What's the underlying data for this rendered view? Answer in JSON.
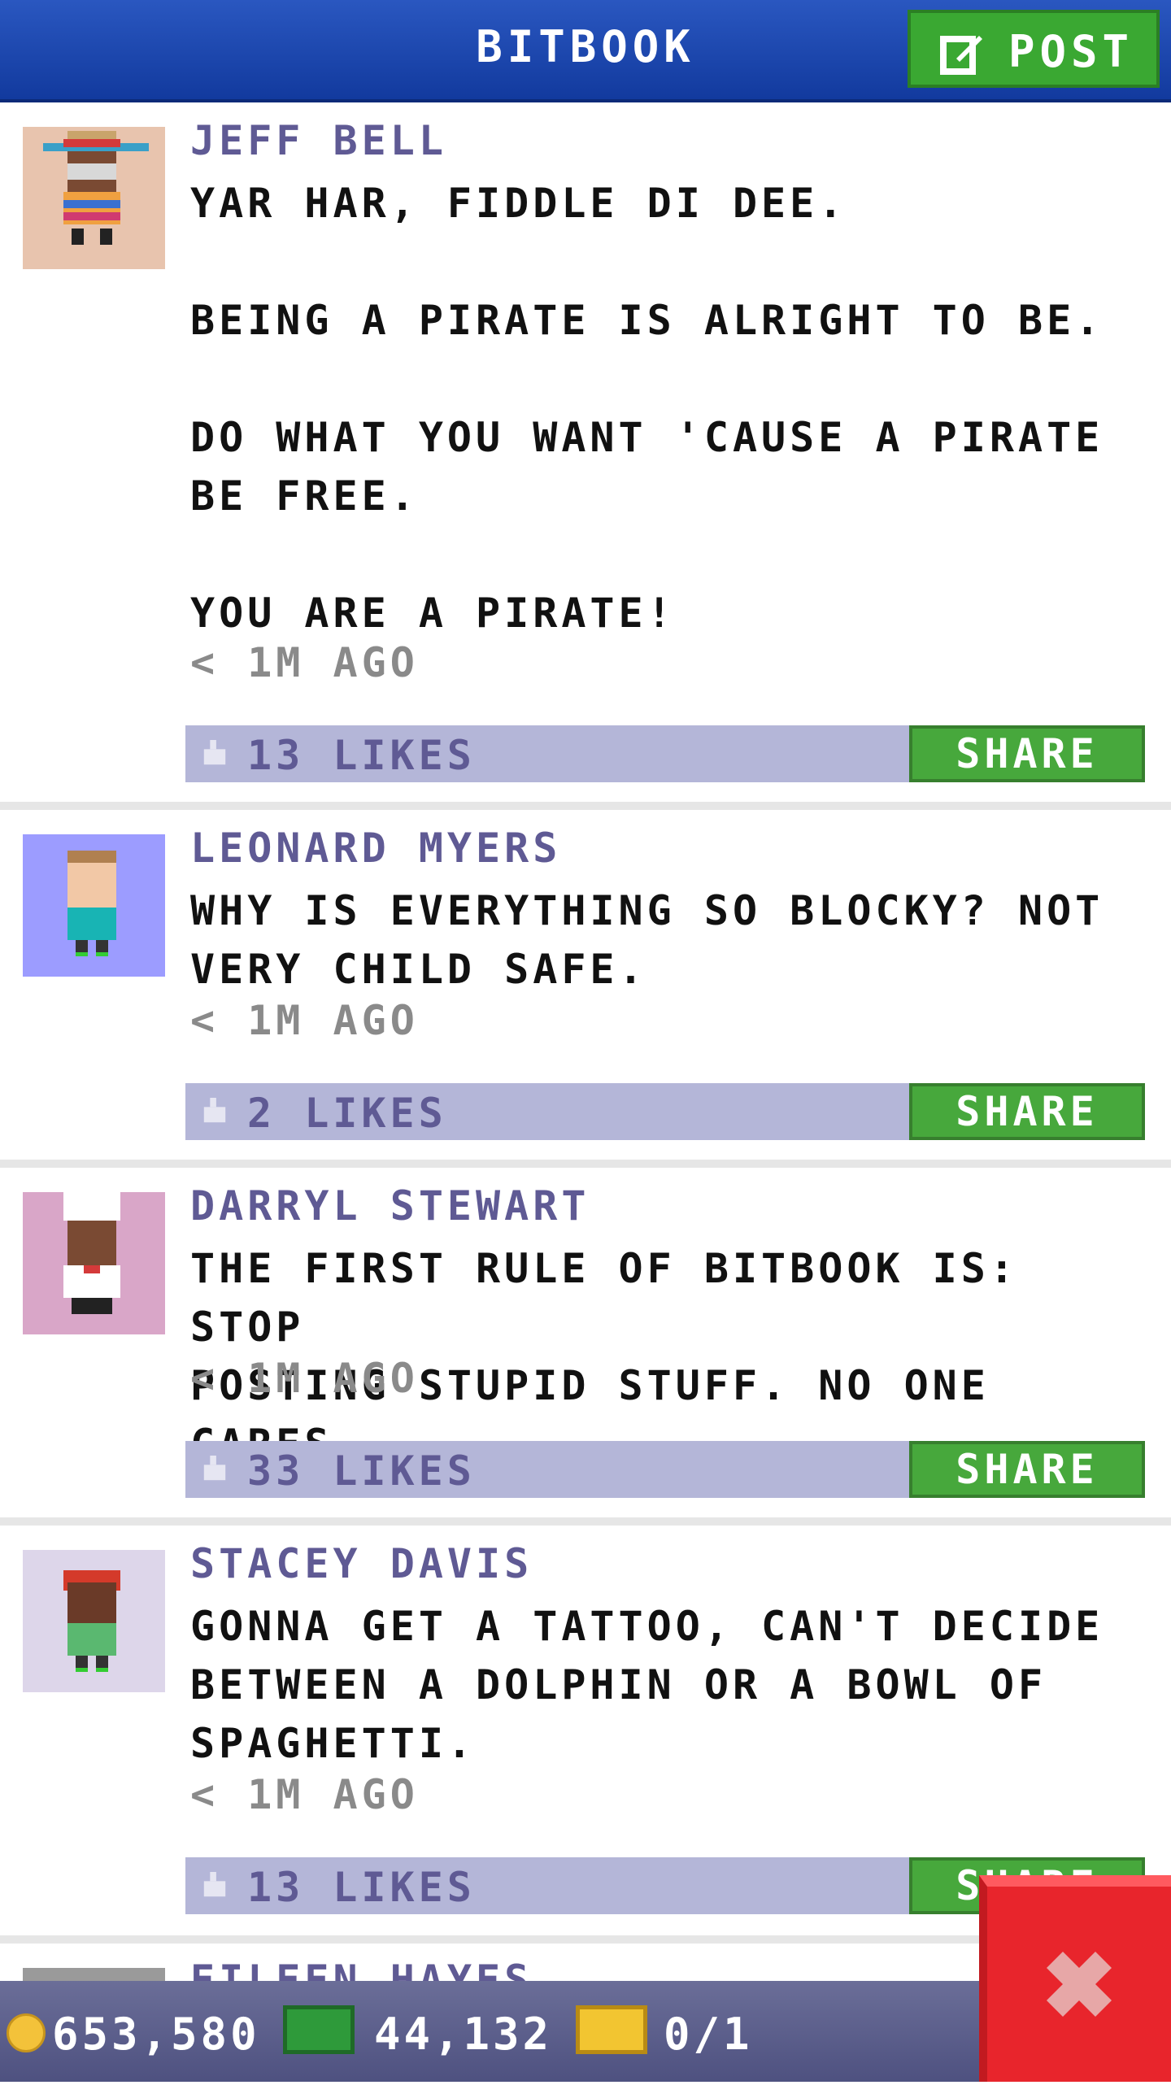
{
  "header": {
    "title": "BITBOOK",
    "post_label": "POST"
  },
  "posts": [
    {
      "author": "JEFF BELL",
      "text": "YAR HAR, FIDDLE DI DEE.\n\nBEING A PIRATE IS ALRIGHT TO BE.\n\nDO WHAT YOU WANT 'CAUSE A PIRATE\nBE FREE.\n\nYOU ARE A PIRATE!",
      "time": "< 1M AGO",
      "likes": "13 LIKES",
      "share": "SHARE",
      "avatar_bg": "#e8c4ae"
    },
    {
      "author": "LEONARD MYERS",
      "text": "WHY IS EVERYTHING SO BLOCKY? NOT\nVERY CHILD SAFE.",
      "time": "< 1M AGO",
      "likes": "2 LIKES",
      "share": "SHARE",
      "avatar_bg": "#9c9cff"
    },
    {
      "author": "DARRYL STEWART",
      "text": "THE FIRST RULE OF BITBOOK IS: STOP\nPOSTING STUPID STUFF. NO ONE CARES.",
      "time": "< 1M AGO",
      "likes": "33 LIKES",
      "share": "SHARE",
      "avatar_bg": "#d9a6c8"
    },
    {
      "author": "STACEY DAVIS",
      "text": "GONNA GET A TATTOO, CAN'T DECIDE\nBETWEEN A DOLPHIN OR A BOWL OF\nSPAGHETTI.",
      "time": "< 1M AGO",
      "likes": "13 LIKES",
      "share": "SHARE",
      "avatar_bg": "#ddd6ea"
    },
    {
      "author": "EILEEN HAYES"
    }
  ],
  "status": {
    "coins": "653,580",
    "cash": "44,132",
    "tickets": "0/1"
  },
  "colors": {
    "header": "#1f4ab4",
    "accent_green": "#3aa832",
    "like_bar": "#b4b6d8",
    "close": "#e8252c"
  }
}
